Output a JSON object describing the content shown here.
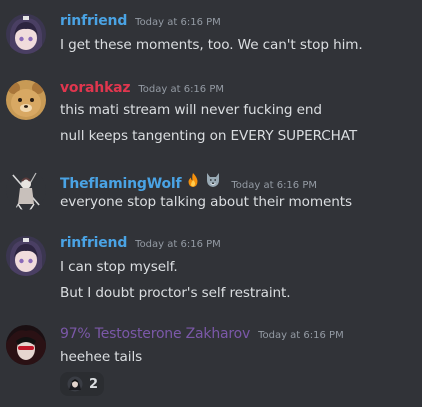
{
  "messages": [
    {
      "username": "rinfriend",
      "username_color": "#4aa3e4",
      "timestamp": "Today at 6:16 PM",
      "avatar": "anime-avatar-icon",
      "lines": [
        "I get these moments, too. We can't stop him."
      ]
    },
    {
      "username": "vorahkaz",
      "username_color": "#e0364e",
      "timestamp": "Today at 6:16 PM",
      "avatar": "bear-avatar-icon",
      "lines": [
        "this mati stream will never fucking end",
        "null keeps tangenting on EVERY SUPERCHAT"
      ]
    },
    {
      "username": "TheflamingWolf",
      "username_color": "#4aa3e4",
      "timestamp": "Today at 6:16 PM",
      "avatar": "sketch-avatar-icon",
      "badges": [
        "fire-icon",
        "wolf-icon"
      ],
      "lines": [
        "everyone stop talking about their moments"
      ]
    },
    {
      "username": "rinfriend",
      "username_color": "#4aa3e4",
      "timestamp": "Today at 6:16 PM",
      "avatar": "anime-avatar-icon",
      "lines": [
        "I can stop myself.",
        "But I doubt proctor's self restraint."
      ]
    },
    {
      "username": "97% Testosterone Zakharov",
      "username_color": "#7b58a8",
      "timestamp": "Today at 6:16 PM",
      "avatar": "vampire-avatar-icon",
      "lines": [
        "heehee tails"
      ],
      "reaction": {
        "emoji": "custom-emoji-icon",
        "count": "2"
      }
    }
  ]
}
